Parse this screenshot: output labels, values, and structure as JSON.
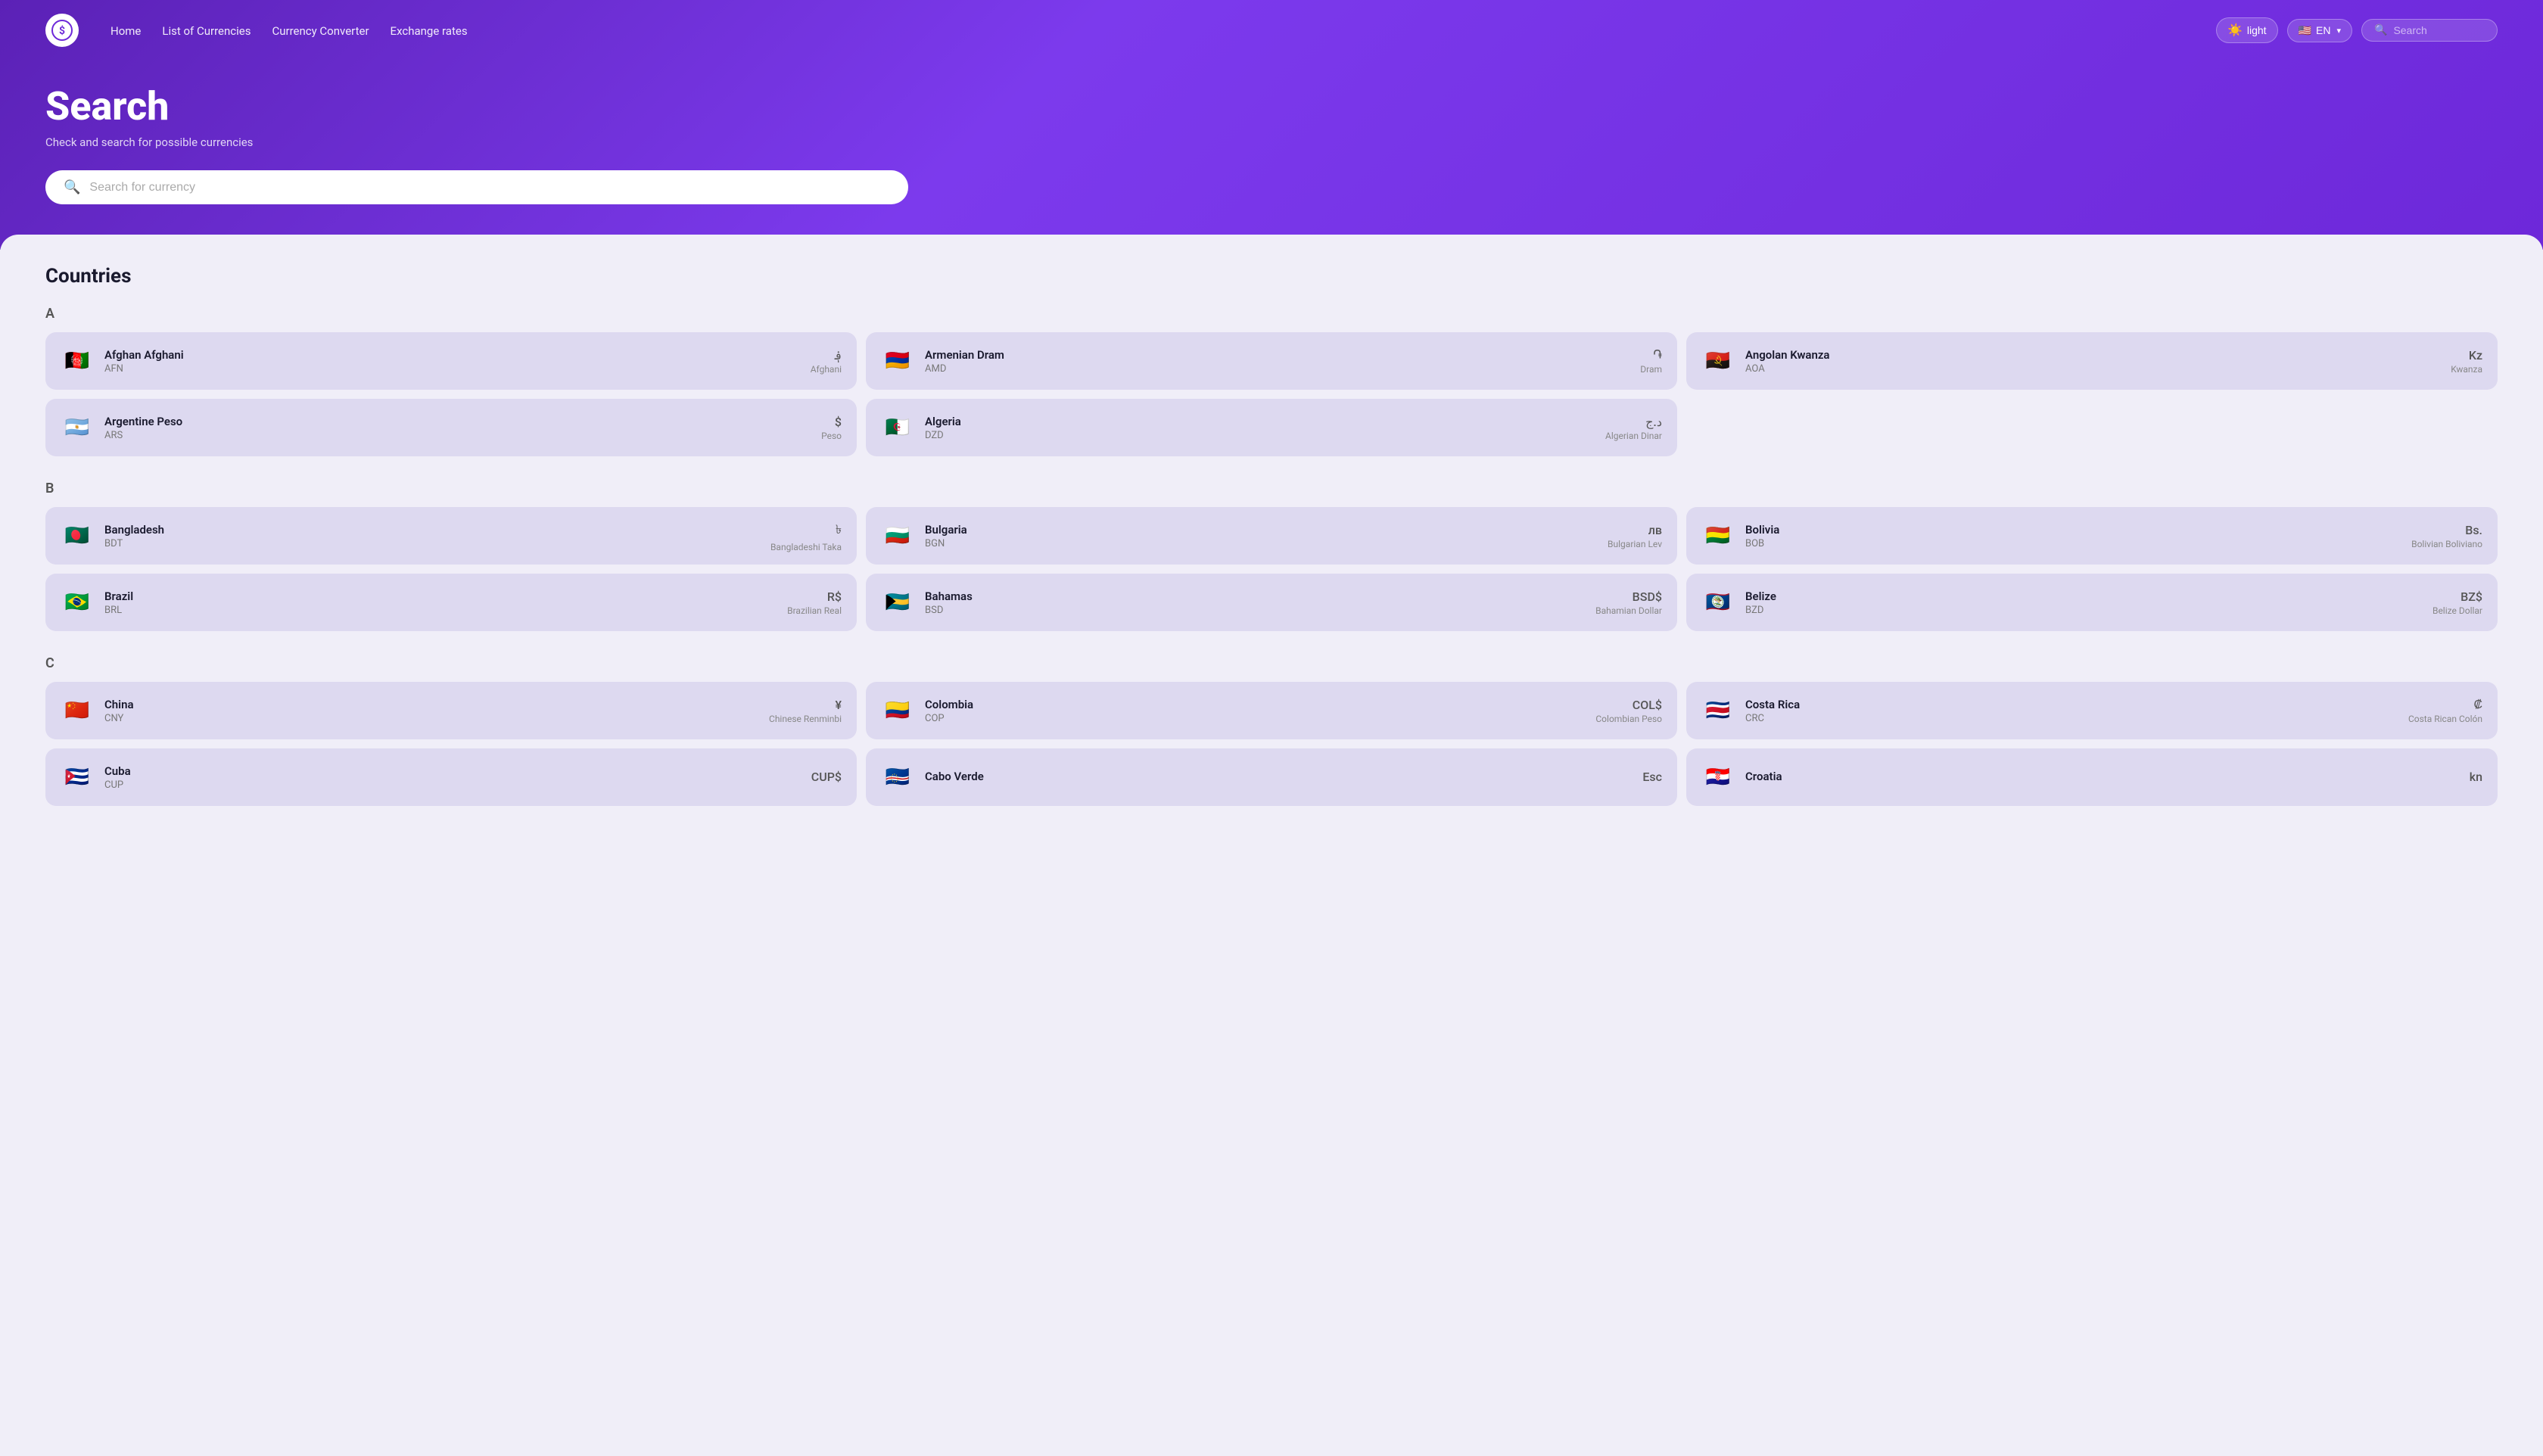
{
  "nav": {
    "home": "Home",
    "listOfCurrencies": "List of Currencies",
    "currencyConverter": "Currency Converter",
    "exchangeRates": "Exchange rates",
    "themeLabel": "light",
    "langLabel": "EN",
    "searchPlaceholder": "Search"
  },
  "hero": {
    "title": "Search",
    "subtitle": "Check and search for possible currencies",
    "searchPlaceholder": "Search for currency"
  },
  "countries": {
    "sectionTitle": "Countries",
    "groups": [
      {
        "letter": "A",
        "items": [
          {
            "name": "Afghan Afghani",
            "code": "AFN",
            "symbol": "؋",
            "symbolName": "Afghani",
            "flag": "🇦🇫"
          },
          {
            "name": "Armenian Dram",
            "code": "AMD",
            "symbol": "֏",
            "symbolName": "Dram",
            "flag": "🇦🇲"
          },
          {
            "name": "Angolan Kwanza",
            "code": "AOA",
            "symbol": "Kz",
            "symbolName": "Kwanza",
            "flag": "🇦🇴"
          },
          {
            "name": "Argentine Peso",
            "code": "ARS",
            "symbol": "$",
            "symbolName": "Peso",
            "flag": "🇦🇷"
          },
          {
            "name": "Algeria",
            "code": "DZD",
            "symbol": "د.ج",
            "symbolName": "Algerian Dinar",
            "flag": "🇩🇿"
          }
        ]
      },
      {
        "letter": "B",
        "items": [
          {
            "name": "Bangladesh",
            "code": "BDT",
            "symbol": "৳",
            "symbolName": "Bangladeshi Taka",
            "flag": "🇧🇩"
          },
          {
            "name": "Bulgaria",
            "code": "BGN",
            "symbol": "лв",
            "symbolName": "Bulgarian Lev",
            "flag": "🇧🇬"
          },
          {
            "name": "Bolivia",
            "code": "BOB",
            "symbol": "Bs.",
            "symbolName": "Bolivian Boliviano",
            "flag": "🇧🇴"
          },
          {
            "name": "Brazil",
            "code": "BRL",
            "symbol": "R$",
            "symbolName": "Brazilian Real",
            "flag": "🇧🇷"
          },
          {
            "name": "Bahamas",
            "code": "BSD",
            "symbol": "BSD$",
            "symbolName": "Bahamian Dollar",
            "flag": "🇧🇸"
          },
          {
            "name": "Belize",
            "code": "BZD",
            "symbol": "BZ$",
            "symbolName": "Belize Dollar",
            "flag": "🇧🇿"
          }
        ]
      },
      {
        "letter": "C",
        "items": [
          {
            "name": "China",
            "code": "CNY",
            "symbol": "¥",
            "symbolName": "Chinese Renminbi",
            "flag": "🇨🇳"
          },
          {
            "name": "Colombia",
            "code": "COP",
            "symbol": "COL$",
            "symbolName": "Colombian Peso",
            "flag": "🇨🇴"
          },
          {
            "name": "Costa Rica",
            "code": "CRC",
            "symbol": "₡",
            "symbolName": "Costa Rican Colón",
            "flag": "🇨🇷"
          },
          {
            "name": "Cuba",
            "code": "CUP",
            "symbol": "CUP$",
            "symbolName": "",
            "flag": "🇨🇺"
          },
          {
            "name": "Cabo Verde",
            "code": "",
            "symbol": "Esc",
            "symbolName": "",
            "flag": "🇨🇻"
          },
          {
            "name": "Croatia",
            "code": "",
            "symbol": "kn",
            "symbolName": "",
            "flag": "🇭🇷"
          }
        ]
      }
    ]
  }
}
